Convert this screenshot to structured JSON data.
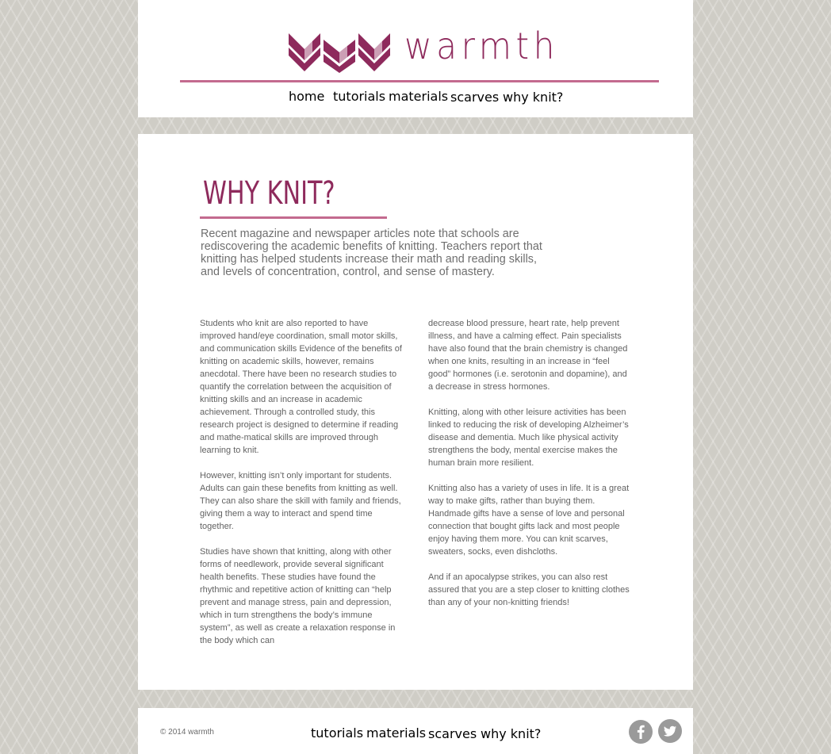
{
  "brand": {
    "name": "warmth",
    "accent_color": "#8e2a5c",
    "rule_color": "#c36a8f"
  },
  "nav": {
    "items": [
      {
        "label": "home"
      },
      {
        "label": "tutorials"
      },
      {
        "label": "materials"
      },
      {
        "label": "scarves"
      },
      {
        "label": "why knit?",
        "active": true
      }
    ]
  },
  "page": {
    "title": "WHY KNIT?",
    "intro": "Recent magazine and newspaper articles note that schools are rediscovering the academic benefits of knitting. Teachers report that knitting has helped students increase their math and reading skills, and levels of concentration, control, and sense of mastery.",
    "left_column": [
      "Students who knit are also reported to have improved hand/eye coordination, small motor skills, and communication skills Evidence of the benefits of knitting on academic skills, however, remains anecdotal. There have been no research studies to quantify the correlation between the acquisition of knitting skills and an increase in academic achievement.  Through a controlled study, this research project is designed to determine if reading and mathe-matical skills are improved through learning to knit.",
      "However, knitting isn’t only important for students. Adults can gain these benefits from knitting as well. They can also share the skill with family and friends, giving them a way to interact and spend time together.",
      "Studies have shown that knitting, along with other forms of needlework, provide several significant health benefits. These studies have found the rhythmic and repetitive action of knitting can “help prevent and manage stress, pain and depression, which in turn strengthens the body’s immune system”, as well as create a relaxation response in the body which can"
    ],
    "right_column": [
      "decrease blood pressure, heart rate, help prevent illness, and have a calming effect. Pain specialists have also found that the brain chemistry is changed when one knits, resulting in an increase in “feel good” hormones (i.e. serotonin and dopamine), and a decrease in stress hormones.",
      "Knitting, along with other leisure activities has been linked to reducing the risk of developing Alzheimer’s disease and dementia. Much like physical activity strengthens the body, mental exercise makes the human brain more resilient.",
      "Knitting also has a variety of uses in life. It is a great way to make gifts, rather than buying them. Handmade gifts have a sense of love and personal connection that bought gifts lack and most people enjoy having them more. You can knit scarves, sweaters, socks, even dishcloths.",
      "And if an apocalypse strikes, you can also rest assured that you are a step closer to knitting clothes than any of your non-knitting friends!"
    ]
  },
  "footer": {
    "copyright": "© 2014 warmth",
    "nav": [
      {
        "label": "tutorials"
      },
      {
        "label": "materials"
      },
      {
        "label": "scarves"
      },
      {
        "label": "why knit?"
      }
    ],
    "social": [
      {
        "icon": "facebook-icon"
      },
      {
        "icon": "twitter-icon"
      }
    ]
  }
}
